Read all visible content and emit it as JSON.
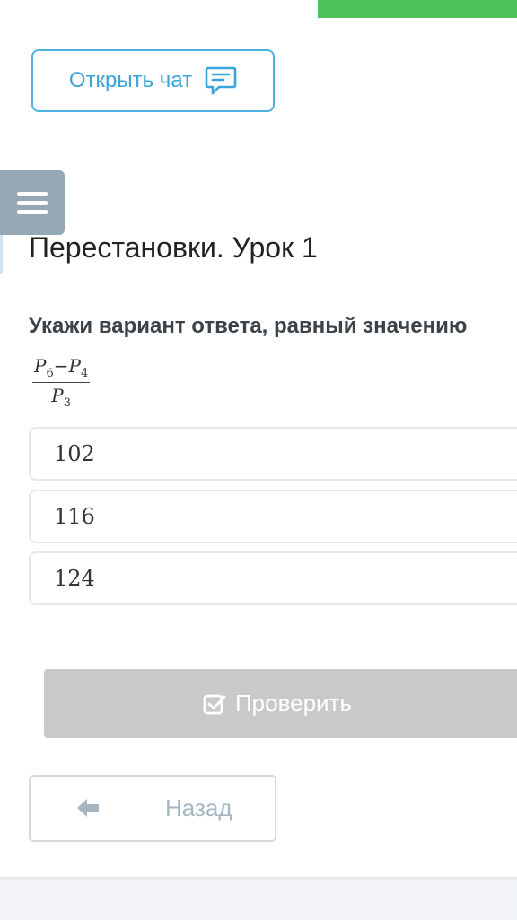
{
  "chat_button": {
    "label": "Открыть чат",
    "icon": "chat-icon"
  },
  "menu": {
    "icon": "hamburger-menu-icon"
  },
  "lesson": {
    "title": "Перестановки. Урок 1"
  },
  "question": {
    "text": "Укажи вариант ответа, равный значению",
    "formula": {
      "numerator_left": "P",
      "numerator_left_sub": "6",
      "minus": "−",
      "numerator_right": "P",
      "numerator_right_sub": "4",
      "denominator": "P",
      "denominator_sub": "3"
    }
  },
  "options": [
    {
      "value": "102"
    },
    {
      "value": "116"
    },
    {
      "value": "124"
    }
  ],
  "check_button": {
    "label": "Проверить",
    "icon": "check-square-icon"
  },
  "back_button": {
    "label": "Назад",
    "icon": "arrow-left-icon"
  },
  "colors": {
    "accent_blue": "#3aa3d8",
    "green_bar": "#4cc45a",
    "menu_bg": "#94a8b5",
    "disabled_button": "#c9c9c9"
  }
}
